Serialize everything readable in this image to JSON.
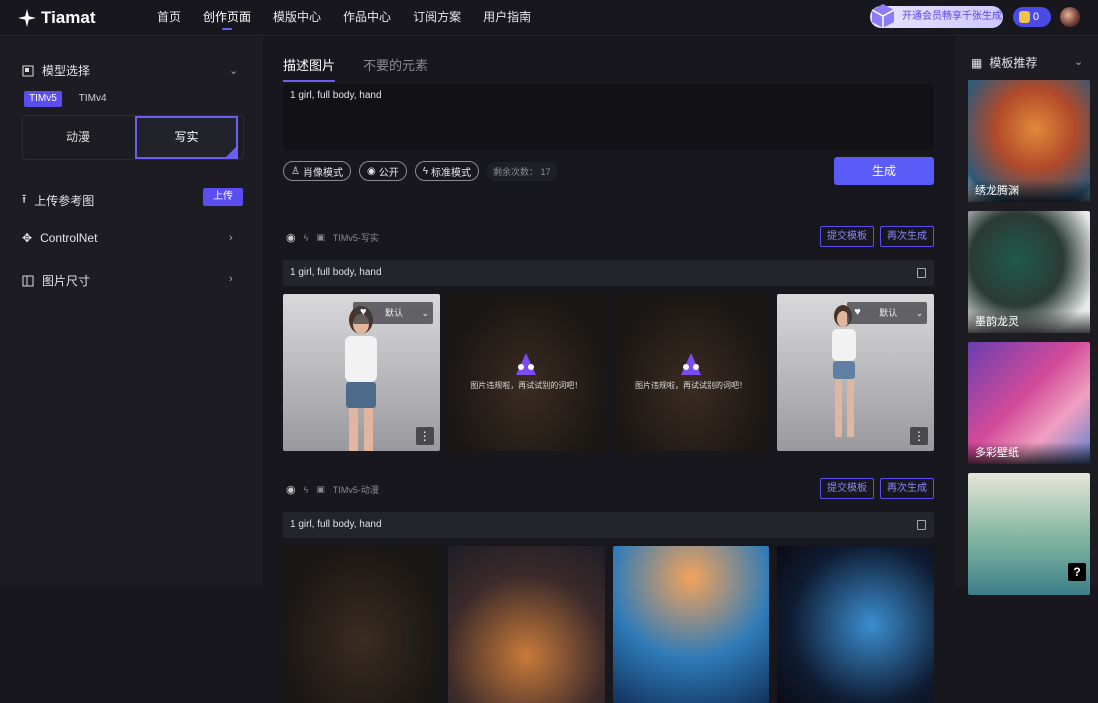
{
  "brand": {
    "name": "Tiamat"
  },
  "nav": [
    "首页",
    "创作页面",
    "模版中心",
    "作品中心",
    "订阅方案",
    "用户指南"
  ],
  "vip": {
    "text": "开通会员畅享千张生成"
  },
  "coins": "0",
  "left": {
    "model_title": "模型选择",
    "model_tags": [
      "TIMv5",
      "TIMv4"
    ],
    "style_options": [
      "动漫",
      "写实"
    ],
    "upload_label": "上传参考图",
    "upload_button": "上传",
    "controlnet": "ControlNet",
    "size": "图片尺寸"
  },
  "main": {
    "tabs": [
      "描述图片",
      "不要的元素"
    ],
    "prompt": "1 girl, full body, hand",
    "pills": [
      "肖像模式",
      "公开",
      "标准模式"
    ],
    "remain": "剩余次数： 17",
    "generate": "生成"
  },
  "groups": [
    {
      "model": "TIMv5-写实",
      "prompt": "1 girl, full body, hand",
      "submit": "提交模板",
      "regen": "再次生成",
      "images": [
        {
          "kind": "photo",
          "dropdown": "默认"
        },
        {
          "kind": "violation",
          "text": "图片违规啦，再试试别的词吧！"
        },
        {
          "kind": "violation",
          "text": "图片违规啦，再试试别的词吧！"
        },
        {
          "kind": "photo",
          "dropdown": "默认"
        }
      ]
    },
    {
      "model": "TIMv5-动漫",
      "prompt": "1 girl, full body, hand",
      "submit": "提交模板",
      "regen": "再次生成"
    }
  ],
  "right": {
    "title": "模板推荐",
    "cards": [
      "绣龙腾渊",
      "墨韵龙灵",
      "多彩壁纸",
      ""
    ]
  },
  "help": "?"
}
